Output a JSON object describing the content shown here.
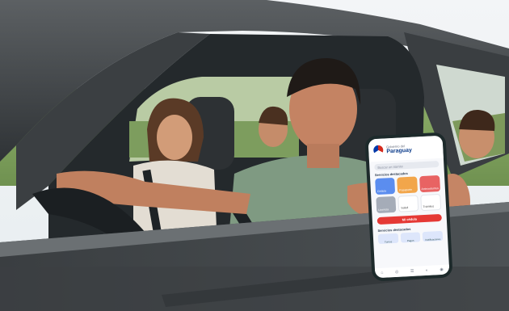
{
  "app": {
    "brand_small": "Gobierno del",
    "brand_name": "Paraguay",
    "search_placeholder": "Buscar un trámite",
    "section_services": "Servicios destacados",
    "tiles": [
      {
        "label": "Cédula"
      },
      {
        "label": "Pasaporte"
      },
      {
        "label": "Antecedentes"
      },
      {
        "label": "Licencia"
      },
      {
        "label": "Salud"
      },
      {
        "label": "Trámites"
      }
    ],
    "cta_label": "Mi cédula",
    "section_2": "Servicios destacados",
    "mini_cards": [
      {
        "label": "Turnos"
      },
      {
        "label": "Pagos"
      },
      {
        "label": "Notificaciones"
      }
    ],
    "tabbar": [
      "⌂",
      "◎",
      "☰",
      "◐",
      "◉"
    ]
  },
  "colors": {
    "flag_red": "#d52b1e",
    "flag_blue": "#0038a8",
    "cta_red": "#e53935",
    "tile_blue": "#5b8def",
    "tile_orange": "#f2a64b",
    "tile_red": "#e86363"
  }
}
